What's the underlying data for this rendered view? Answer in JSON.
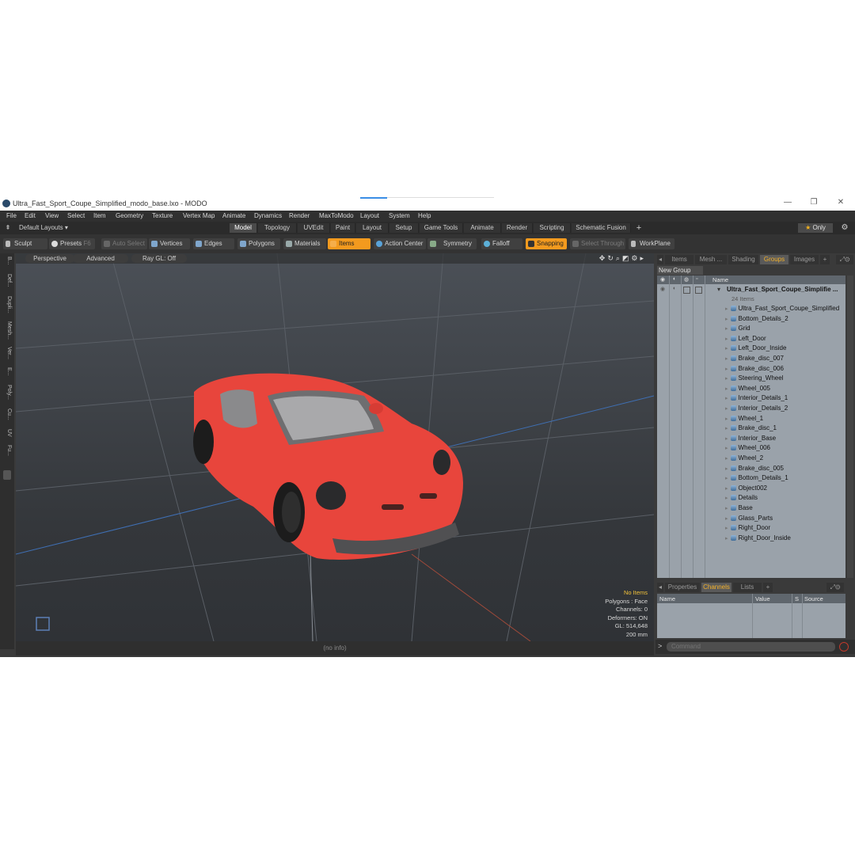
{
  "window": {
    "title": "Ultra_Fast_Sport_Coupe_Simplified_modo_base.lxo - MODO",
    "controls": [
      "—",
      "❐",
      "✕"
    ]
  },
  "menu": [
    "File",
    "Edit",
    "View",
    "Select",
    "Item",
    "Geometry",
    "Texture",
    "Vertex Map",
    "Animate",
    "Dynamics",
    "Render",
    "MaxToModo",
    "Layout",
    "System",
    "Help"
  ],
  "layout": {
    "default_layouts": "Default Layouts ▾",
    "tabs": [
      "Model",
      "Topology",
      "UVEdit",
      "Paint",
      "Layout",
      "Setup",
      "Game Tools",
      "Animate",
      "Render",
      "Scripting",
      "Schematic Fusion"
    ],
    "active_tab": "Model",
    "add": "+",
    "only": "Only"
  },
  "toolbar": {
    "sculpt": "Sculpt",
    "presets": "Presets",
    "presets_key": "F6",
    "auto_select": "Auto Select",
    "vertices": "Vertices",
    "edges": "Edges",
    "polygons": "Polygons",
    "materials": "Materials",
    "items": "Items",
    "action_center": "Action Center",
    "symmetry": "Symmetry",
    "falloff": "Falloff",
    "snapping": "Snapping",
    "select_through": "Select Through",
    "workplane": "WorkPlane"
  },
  "left_strip": [
    "B...",
    "Def...",
    "Dupli...",
    "Mesh...",
    "Ver...",
    "E...",
    "Poly...",
    "Cu...",
    "UV",
    "Fu..."
  ],
  "viewport": {
    "view": "Perspective",
    "advanced": "Advanced",
    "raygl": "Ray GL: Off",
    "info": {
      "no_items": "No Items",
      "polygons": "Polygons : Face",
      "channels": "Channels: 0",
      "deformers": "Deformers: ON",
      "gl": "GL: 514,648",
      "scale": "200 mm"
    },
    "status": "(no info)"
  },
  "right_panel": {
    "tabs": [
      "Items",
      "Mesh ...",
      "Shading",
      "Groups",
      "Images",
      "+"
    ],
    "active_tab": "Groups",
    "new_group": "New Group",
    "name_header": "Name",
    "group_name": "Ultra_Fast_Sport_Coupe_Simplifie ...",
    "item_count": "24 Items",
    "items": [
      "Ultra_Fast_Sport_Coupe_Simplified",
      "Bottom_Details_2",
      "Grid",
      "Left_Door",
      "Left_Door_Inside",
      "Brake_disc_007",
      "Brake_disc_006",
      "Steering_Wheel",
      "Wheel_005",
      "Interior_Details_1",
      "Interior_Details_2",
      "Wheel_1",
      "Brake_disc_1",
      "Interior_Base",
      "Wheel_006",
      "Wheel_2",
      "Brake_disc_005",
      "Bottom_Details_1",
      "Object002",
      "Details",
      "Base",
      "Glass_Parts",
      "Right_Door",
      "Right_Door_Inside"
    ],
    "bottom_tabs": [
      "Properties",
      "Channels",
      "Lists",
      "+"
    ],
    "bottom_active": "Channels",
    "channel_headers": [
      "Name",
      "Value",
      "S",
      "Source"
    ],
    "command_placeholder": "Command"
  },
  "colors": {
    "accent": "#f39a1e",
    "car_body": "#e8453c"
  }
}
